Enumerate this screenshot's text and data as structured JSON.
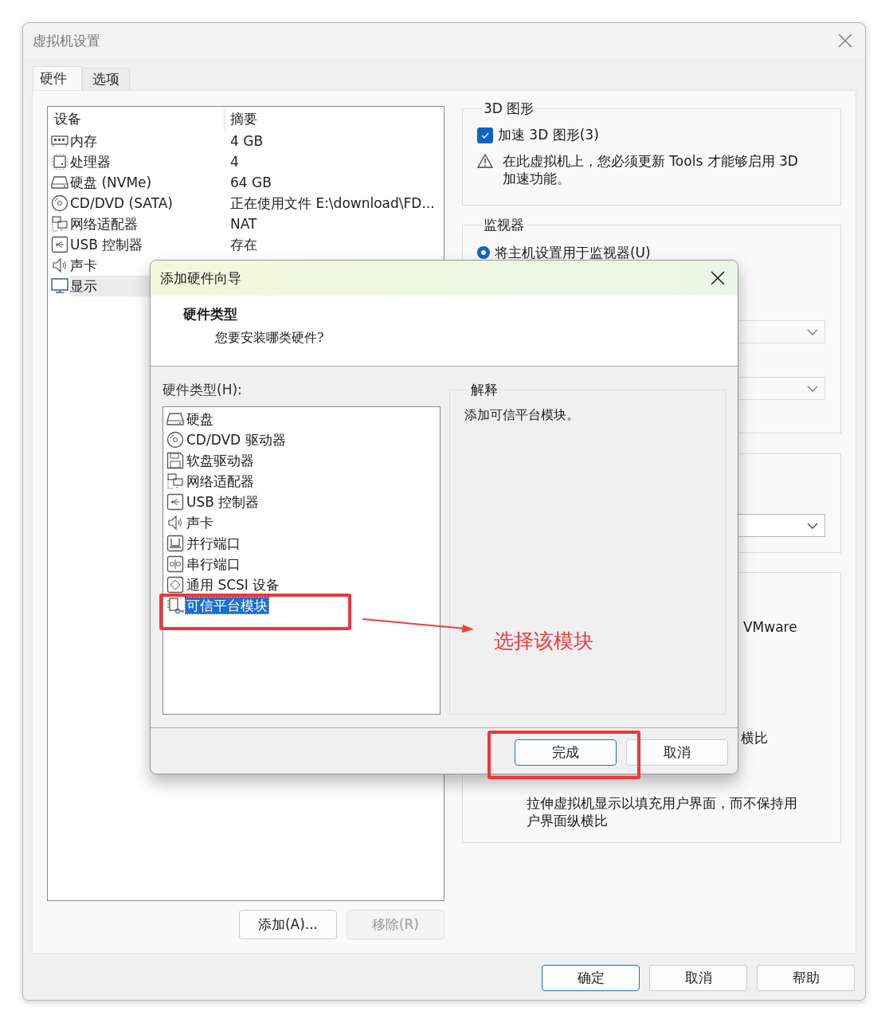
{
  "window": {
    "title": "虚拟机设置"
  },
  "tabs": [
    {
      "label": "硬件",
      "selected": true
    },
    {
      "label": "选项",
      "selected": false
    }
  ],
  "devices": {
    "columns": [
      "设备",
      "摘要"
    ],
    "rows": [
      {
        "kind": "memory",
        "name": "内存",
        "summary": "4 GB",
        "selected": false
      },
      {
        "kind": "cpu",
        "name": "处理器",
        "summary": "4",
        "selected": false
      },
      {
        "kind": "disk",
        "name": "硬盘 (NVMe)",
        "summary": "64 GB",
        "selected": false
      },
      {
        "kind": "cdrom",
        "name": "CD/DVD (SATA)",
        "summary": "正在使用文件 E:\\download\\FD...",
        "selected": false
      },
      {
        "kind": "network",
        "name": "网络适配器",
        "summary": "NAT",
        "selected": false
      },
      {
        "kind": "usb",
        "name": "USB 控制器",
        "summary": "存在",
        "selected": false
      },
      {
        "kind": "sound",
        "name": "声卡",
        "selected": false
      },
      {
        "kind": "display",
        "name": "显示",
        "selected": true
      }
    ]
  },
  "device_buttons": [
    {
      "label": "添加(A)...",
      "disabled": false
    },
    {
      "label": "移除(R)",
      "disabled": true
    }
  ],
  "graphics_3d": {
    "title": "3D 图形",
    "accelerate": {
      "label": "加速 3D 图形(3)",
      "checked": true
    },
    "warning": "在此虚拟机上，您必须更新 Tools 才能够启用 3D 加速功能。"
  },
  "monitors": {
    "title": "监视器",
    "option": {
      "label": "将主机设置用于监视器(U)",
      "selected": true
    }
  },
  "scaling": {
    "text_1": "VMware",
    "text_2": "横比",
    "description": "拉伸虚拟机显示以填充用户界面，而不保持用户界面纵横比"
  },
  "footer_buttons": [
    {
      "label": "确定",
      "default": true
    },
    {
      "label": "取消",
      "default": false
    },
    {
      "label": "帮助",
      "default": false
    }
  ],
  "wizard": {
    "title": "添加硬件向导",
    "heading": "硬件类型",
    "subheading": "您要安装哪类硬件?",
    "list_label": "硬件类型(H):",
    "items": [
      {
        "kind": "disk",
        "label": "硬盘",
        "selected": false
      },
      {
        "kind": "cdrom",
        "label": "CD/DVD 驱动器",
        "selected": false
      },
      {
        "kind": "floppy",
        "label": "软盘驱动器",
        "selected": false
      },
      {
        "kind": "network",
        "label": "网络适配器",
        "selected": false
      },
      {
        "kind": "usb",
        "label": "USB 控制器",
        "selected": false
      },
      {
        "kind": "sound",
        "label": "声卡",
        "selected": false
      },
      {
        "kind": "parallel",
        "label": "并行端口",
        "selected": false
      },
      {
        "kind": "serial",
        "label": "串行端口",
        "selected": false
      },
      {
        "kind": "scsi",
        "label": "通用 SCSI 设备",
        "selected": false
      },
      {
        "kind": "tpm",
        "label": "可信平台模块",
        "selected": true
      }
    ],
    "explain_title": "解释",
    "explain_text": "添加可信平台模块。",
    "buttons": [
      {
        "label": "完成",
        "default": true
      },
      {
        "label": "取消",
        "default": false
      }
    ]
  },
  "annotation": {
    "text": "选择该模块"
  }
}
